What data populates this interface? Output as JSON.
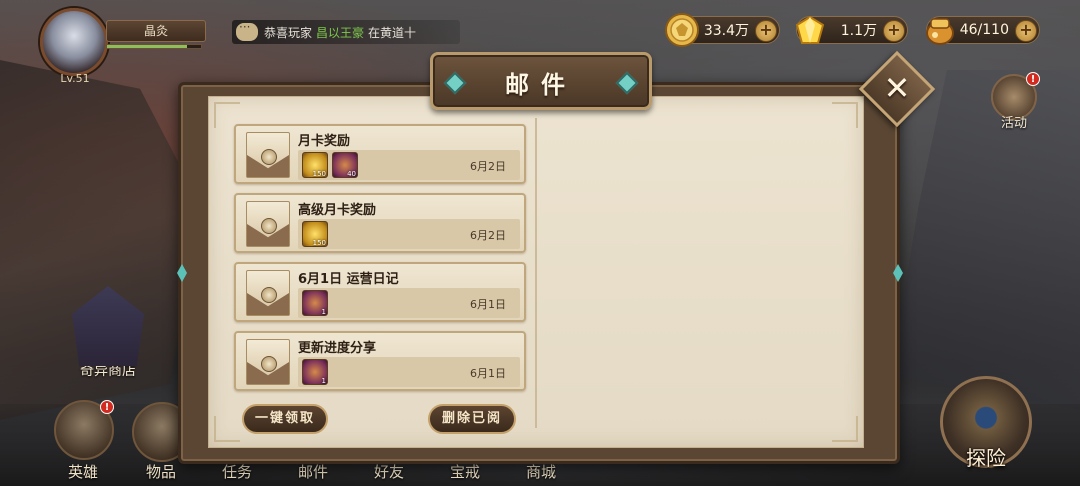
{
  "player": {
    "name": "晶灸",
    "level": "Lv.51",
    "exp_progress": 0.85
  },
  "chat": {
    "prefix": "恭喜玩家",
    "player_name": "昌以王豪",
    "suffix": "在黄道十"
  },
  "currencies": {
    "gold": {
      "value": "33.4万",
      "icon": "gold-coin-icon"
    },
    "diamond": {
      "value": "1.1万",
      "icon": "diamond-icon"
    },
    "stamina": {
      "value": "46/110",
      "icon": "stamina-icon"
    }
  },
  "side": {
    "event_label": "活动",
    "shop_label": "奇异商店",
    "explore_label": "探险",
    "alert_mark": "!"
  },
  "nav": {
    "hero": "英雄",
    "items": "物品",
    "quests": "任务",
    "mail": "邮件",
    "friends": "好友",
    "rings": "宝戒",
    "market": "商城"
  },
  "dialog": {
    "title": "邮件",
    "close": "✕",
    "claim_all": "一键领取",
    "delete_read": "删除已阅"
  },
  "mails": [
    {
      "title": "月卡奖励",
      "date": "6月2日",
      "attachments": [
        {
          "type": "diamond",
          "count": "150"
        },
        {
          "type": "chest",
          "count": "40"
        }
      ]
    },
    {
      "title": "高级月卡奖励",
      "date": "6月2日",
      "attachments": [
        {
          "type": "diamond",
          "count": "150"
        }
      ]
    },
    {
      "title": "6月1日 运营日记",
      "date": "6月1日",
      "attachments": [
        {
          "type": "chest",
          "count": "1"
        }
      ]
    },
    {
      "title": "更新进度分享",
      "date": "6月1日",
      "attachments": [
        {
          "type": "chest",
          "count": "1"
        }
      ]
    }
  ],
  "colors": {
    "accent_gold": "#c4a06a",
    "paper": "#ece3d0",
    "frame": "#5a4633"
  }
}
